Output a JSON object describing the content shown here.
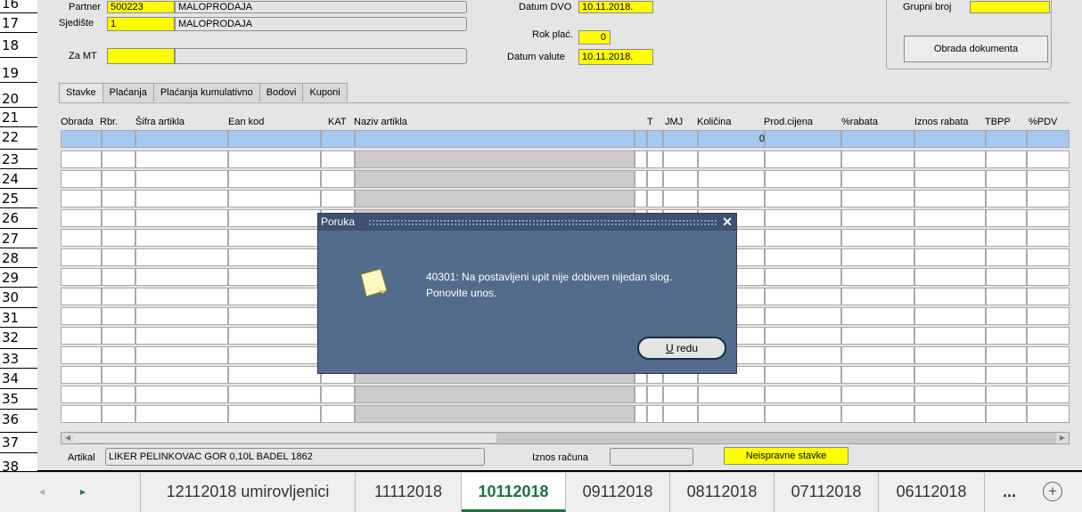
{
  "row_numbers": [
    "16",
    "17",
    "18",
    "19",
    "20",
    "21",
    "22",
    "23",
    "24",
    "25",
    "26",
    "27",
    "28",
    "29",
    "30",
    "31",
    "32",
    "33",
    "34",
    "35",
    "36",
    "37",
    "38"
  ],
  "header": {
    "partner_label": "Partner",
    "partner_code": "500223",
    "partner_name": "MALOPRODAJA",
    "sjediste_label": "Sjedište",
    "sjediste_code": "1",
    "sjediste_name": "MALOPRODAJA",
    "zamt_label": "Za MT",
    "datum_dvo_label": "Datum DVO",
    "datum_dvo": "10.11.2018.",
    "rok_plac_label": "Rok plać.",
    "rok_plac": "0",
    "datum_valute_label": "Datum valute",
    "datum_valute": "10.11.2018.",
    "grupni_broj_label": "Grupni broj",
    "obrada_button": "Obrada dokumenta"
  },
  "tabs": [
    "Stavke",
    "Plaćanja",
    "Plaćanja kumulativno",
    "Bodovi",
    "Kuponi"
  ],
  "columns": [
    "Obrada",
    "Rbr.",
    "Šifra artikla",
    "Ean kod",
    "KAT",
    "Naziv artikla",
    "T",
    "JMJ",
    "Količina",
    "Prod.cijena",
    "%rabata",
    "Iznos rabata",
    "TBPP",
    "%PDV"
  ],
  "first_row_kolicina": "0",
  "footer": {
    "artikal_label": "Artikal",
    "artikal_value": "LIKER PELINKOVAC GOR 0,10L BADEL 1862",
    "iznos_label": "Iznos računa",
    "neispravne_label": "Neispravne stavke"
  },
  "dialog": {
    "title": "Poruka",
    "close": "✕",
    "message_line1": "40301: Na postavljeni upit nije dobiven nijedan slog.",
    "message_line2": "Ponovite unos.",
    "ok_underlined": "U",
    "ok_rest": " redu"
  },
  "sheet_tabs": [
    "12112018 umirovljenici",
    "11112018",
    "10112018",
    "09112018",
    "08112018",
    "07112018",
    "06112018"
  ],
  "active_sheet": "10112018",
  "sheet_more": "...",
  "sheet_add": "+",
  "colors": {
    "yellow": "#ffff00",
    "dialog_bg": "#536b8d",
    "selected_row": "#a6c8f0",
    "excel_green": "#1e7145"
  }
}
